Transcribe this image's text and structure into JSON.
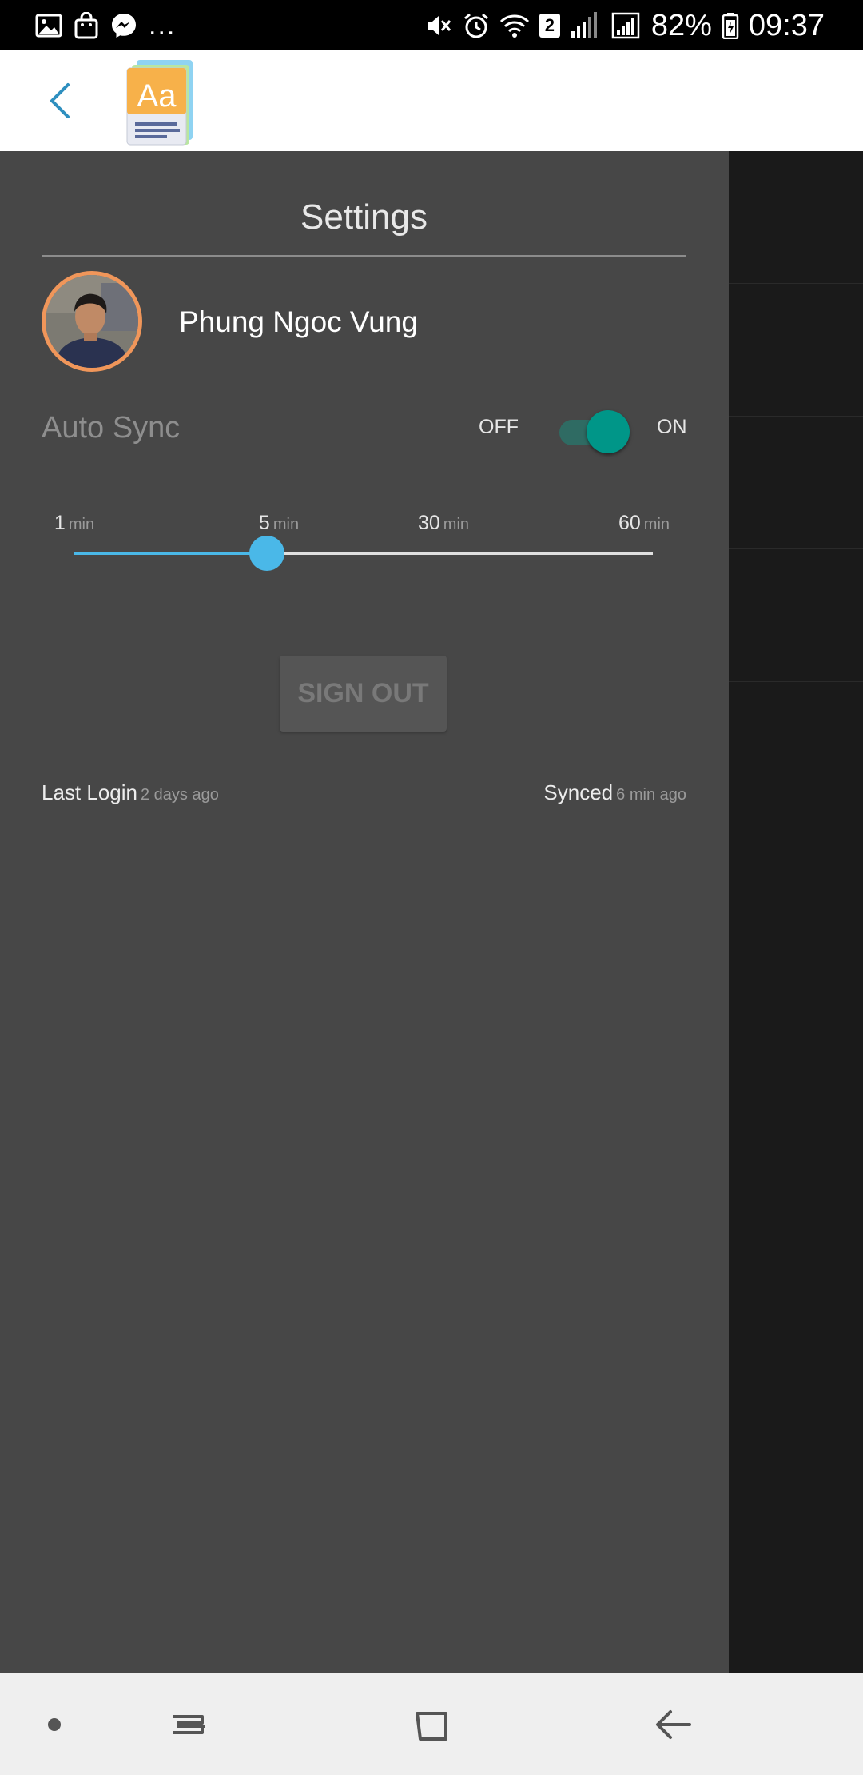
{
  "status_bar": {
    "left_icons": [
      "image-icon",
      "shopping-bag-icon",
      "messenger-icon"
    ],
    "more_indicator": "...",
    "right_icons": [
      "mute-icon",
      "alarm-icon",
      "wifi-icon",
      "signal-icon"
    ],
    "sim_badge": "2",
    "battery_percent": "82%",
    "time": "09:37"
  },
  "app_bar": {
    "back_icon": "chevron-left-icon",
    "logo_icon": "dictionary-logo-icon",
    "logo_text": "Aa"
  },
  "drawer": {
    "title": "Settings",
    "user": {
      "name": "Phung Ngoc Vung",
      "avatar_border_color": "#f0965a"
    },
    "auto_sync": {
      "label": "Auto Sync",
      "off_label": "OFF",
      "on_label": "ON",
      "enabled": true,
      "accent_color": "#009688"
    },
    "interval_slider": {
      "stops": [
        {
          "value": "1",
          "unit": "min"
        },
        {
          "value": "5",
          "unit": "min"
        },
        {
          "value": "30",
          "unit": "min"
        },
        {
          "value": "60",
          "unit": "min"
        }
      ],
      "selected_stop_index": 1,
      "accent_color": "#4ab8e8"
    },
    "sign_out_label": "SIGN OUT",
    "last_login": {
      "label": "Last Login",
      "value": "2 days ago"
    },
    "synced": {
      "label": "Synced",
      "value": "6 min ago"
    }
  },
  "nav_bar": {
    "icons": [
      "dot-icon",
      "recent-apps-icon",
      "home-icon",
      "back-arrow-icon"
    ]
  }
}
